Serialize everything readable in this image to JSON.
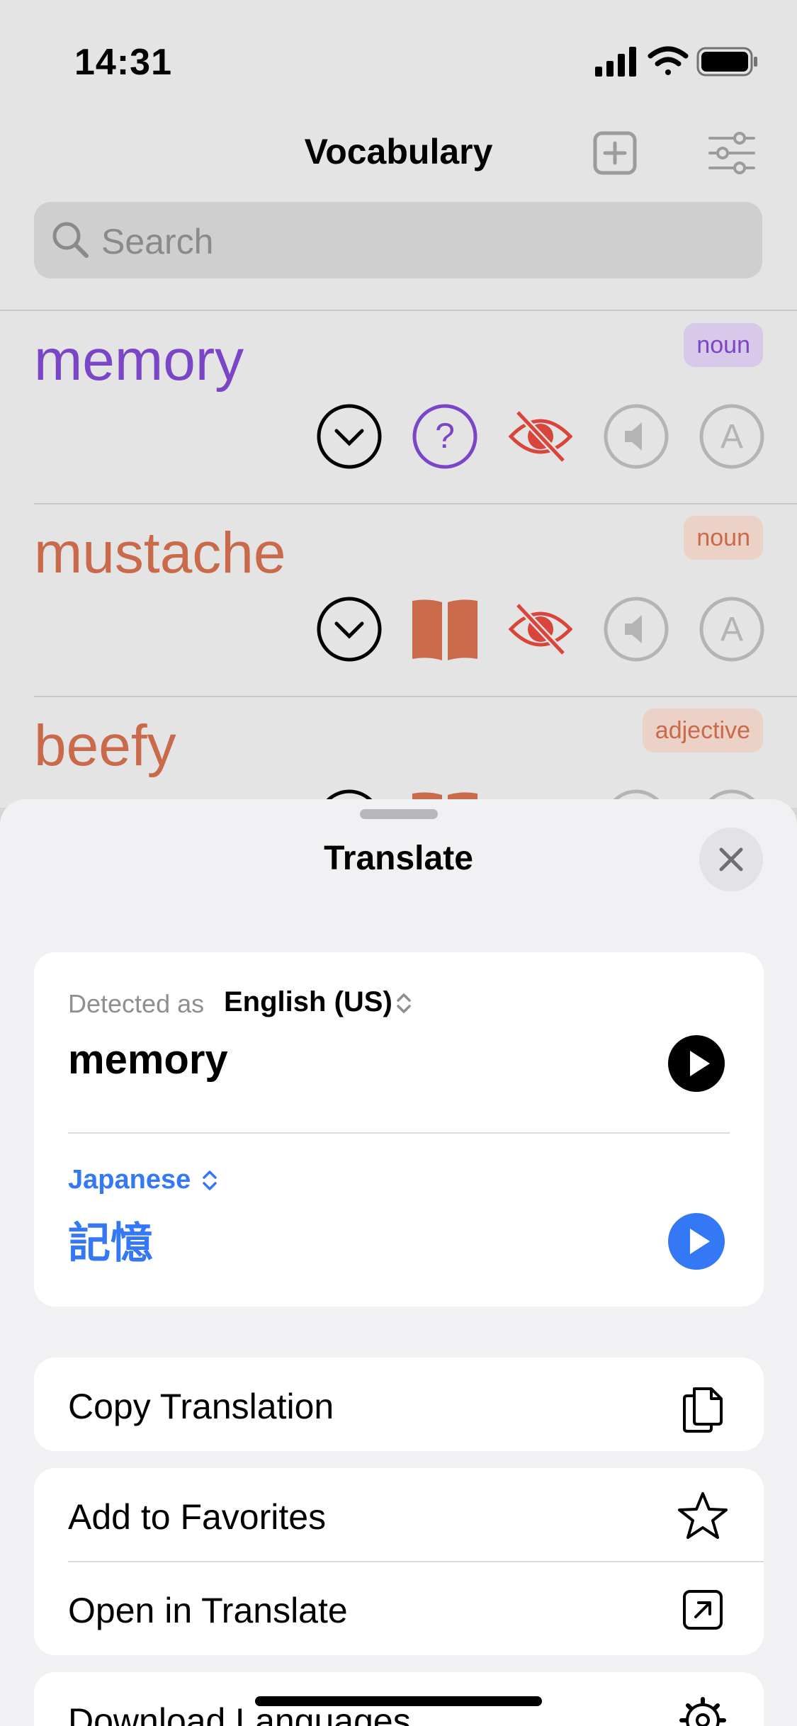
{
  "status": {
    "time": "14:31"
  },
  "nav": {
    "title": "Vocabulary"
  },
  "search": {
    "placeholder": "Search"
  },
  "words": [
    {
      "word": "memory",
      "pos": "noun",
      "color": "#7b45c8",
      "pos_bg": "#d8c8ea"
    },
    {
      "word": "mustache",
      "pos": "noun",
      "color": "#c96a4a",
      "pos_bg": "#ecd1c6"
    },
    {
      "word": "beefy",
      "pos": "adjective",
      "color": "#c96a4a",
      "pos_bg": "#ecd1c6"
    }
  ],
  "sheet": {
    "title": "Translate",
    "detected_prefix": "Detected as",
    "source_language": "English (US)",
    "source_text": "memory",
    "target_language": "Japanese",
    "target_text": "記憶",
    "actions": {
      "copy": "Copy Translation",
      "favorites": "Add to Favorites",
      "open": "Open in Translate",
      "download": "Download Languages"
    }
  },
  "colors": {
    "accent": "#3478f6",
    "purple": "#7b45c8",
    "orange": "#c96a4a",
    "red": "#d9453a"
  }
}
